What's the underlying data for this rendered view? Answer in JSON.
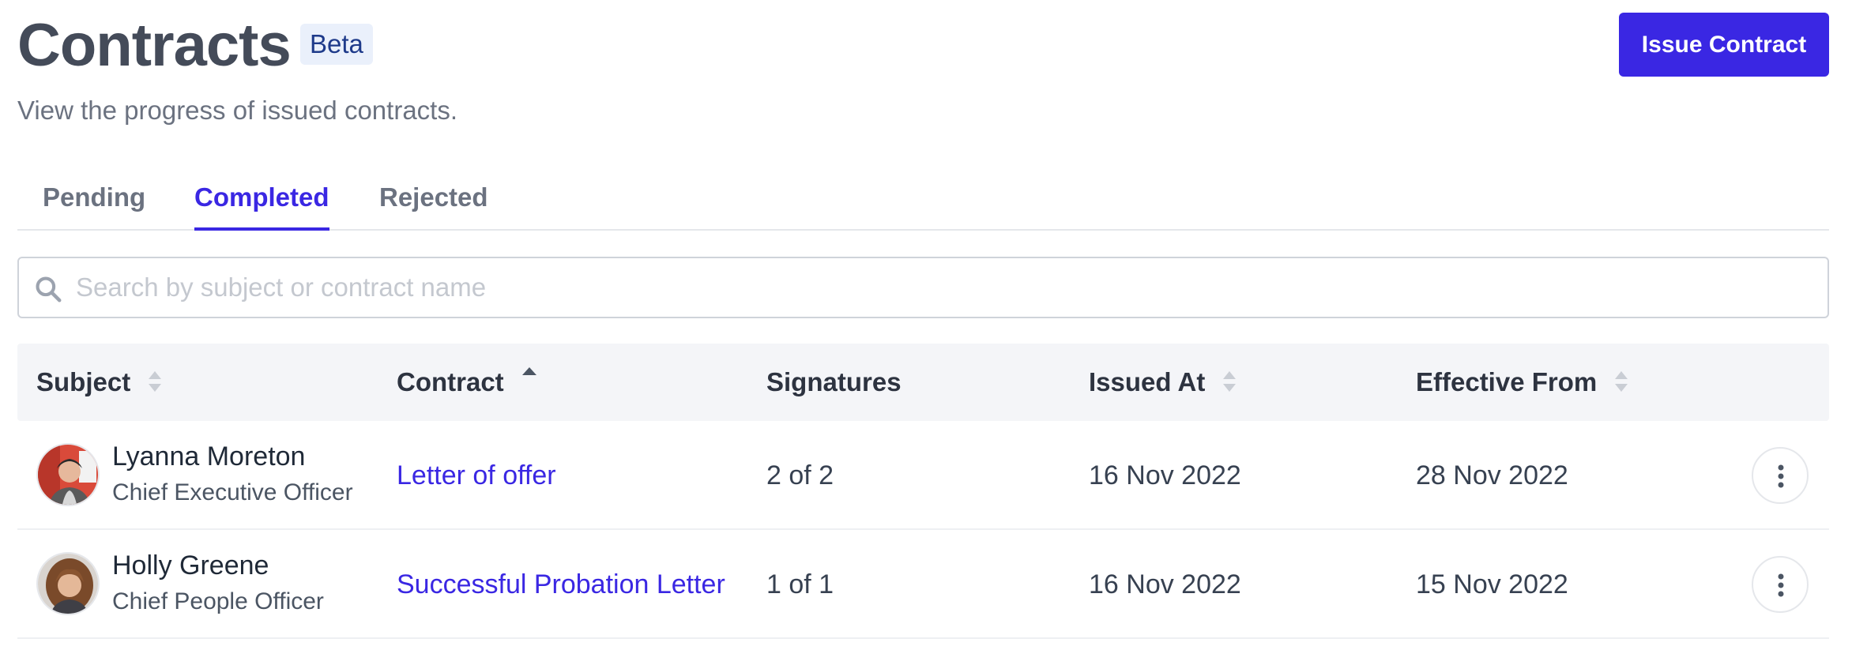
{
  "header": {
    "title": "Contracts",
    "badge": "Beta",
    "subtitle": "View the progress of issued contracts.",
    "issue_button": "Issue Contract"
  },
  "tabs": [
    {
      "label": "Pending",
      "active": false
    },
    {
      "label": "Completed",
      "active": true
    },
    {
      "label": "Rejected",
      "active": false
    }
  ],
  "search": {
    "placeholder": "Search by subject or contract name",
    "value": "",
    "icon": "search-icon"
  },
  "table": {
    "columns": [
      {
        "label": "Subject",
        "sort": "none"
      },
      {
        "label": "Contract",
        "sort": "ascending"
      },
      {
        "label": "Signatures",
        "sort": "not-sortable"
      },
      {
        "label": "Issued At",
        "sort": "none"
      },
      {
        "label": "Effective From",
        "sort": "none"
      }
    ],
    "rows": [
      {
        "name": "Lyanna Moreton",
        "role": "Chief Executive Officer",
        "contract": "Letter of offer",
        "signatures": "2 of 2",
        "issued_at": "16 Nov 2022",
        "effective_from": "28 Nov 2022"
      },
      {
        "name": "Holly Greene",
        "role": "Chief People Officer",
        "contract": "Successful Probation Letter",
        "signatures": "1 of 1",
        "issued_at": "16 Nov 2022",
        "effective_from": "15 Nov 2022"
      }
    ]
  },
  "colors": {
    "accent": "#3a27e3",
    "title": "#444b59",
    "badge_bg": "#eaf0fb",
    "header_bg": "#f4f5f8"
  }
}
